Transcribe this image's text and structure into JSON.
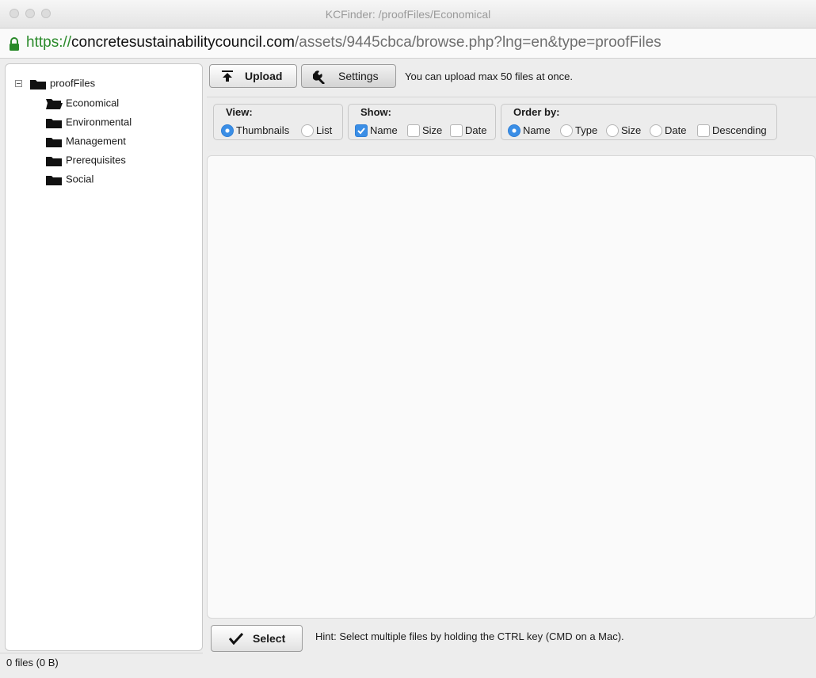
{
  "window": {
    "title": "KCFinder: /proofFiles/Economical"
  },
  "address_bar": {
    "scheme": "https://",
    "host": "concretesustainabilitycouncil.com",
    "path": "/assets/9445cbca/browse.php?lng=en&type=proofFiles"
  },
  "folder_tree": {
    "root": "proofFiles",
    "children": [
      "Economical",
      "Environmental",
      "Management",
      "Prerequisites",
      "Social"
    ],
    "open_folder": "Economical"
  },
  "toolbar": {
    "upload_label": "Upload",
    "settings_label": "Settings",
    "hint": "You can upload max 50 files at once."
  },
  "options": {
    "view": {
      "title": "View:",
      "items": [
        {
          "label": "Thumbnails",
          "selected": true
        },
        {
          "label": "List",
          "selected": false
        }
      ]
    },
    "show": {
      "title": "Show:",
      "items": [
        {
          "label": "Name",
          "checked": true
        },
        {
          "label": "Size",
          "checked": false
        },
        {
          "label": "Date",
          "checked": false
        }
      ]
    },
    "order_by": {
      "title": "Order by:",
      "items": [
        {
          "label": "Name",
          "selected": true
        },
        {
          "label": "Type",
          "selected": false
        },
        {
          "label": "Size",
          "selected": false
        },
        {
          "label": "Date",
          "selected": false
        }
      ],
      "descending": {
        "label": "Descending",
        "checked": false
      }
    }
  },
  "bottom": {
    "select_label": "Select",
    "hint": "Hint: Select multiple files by holding the CTRL key (CMD on a Mac)."
  },
  "status": {
    "text": "0 files (0 B)"
  },
  "colors": {
    "accent": "#3a8ee6",
    "secure_green": "#2a8a2a"
  }
}
